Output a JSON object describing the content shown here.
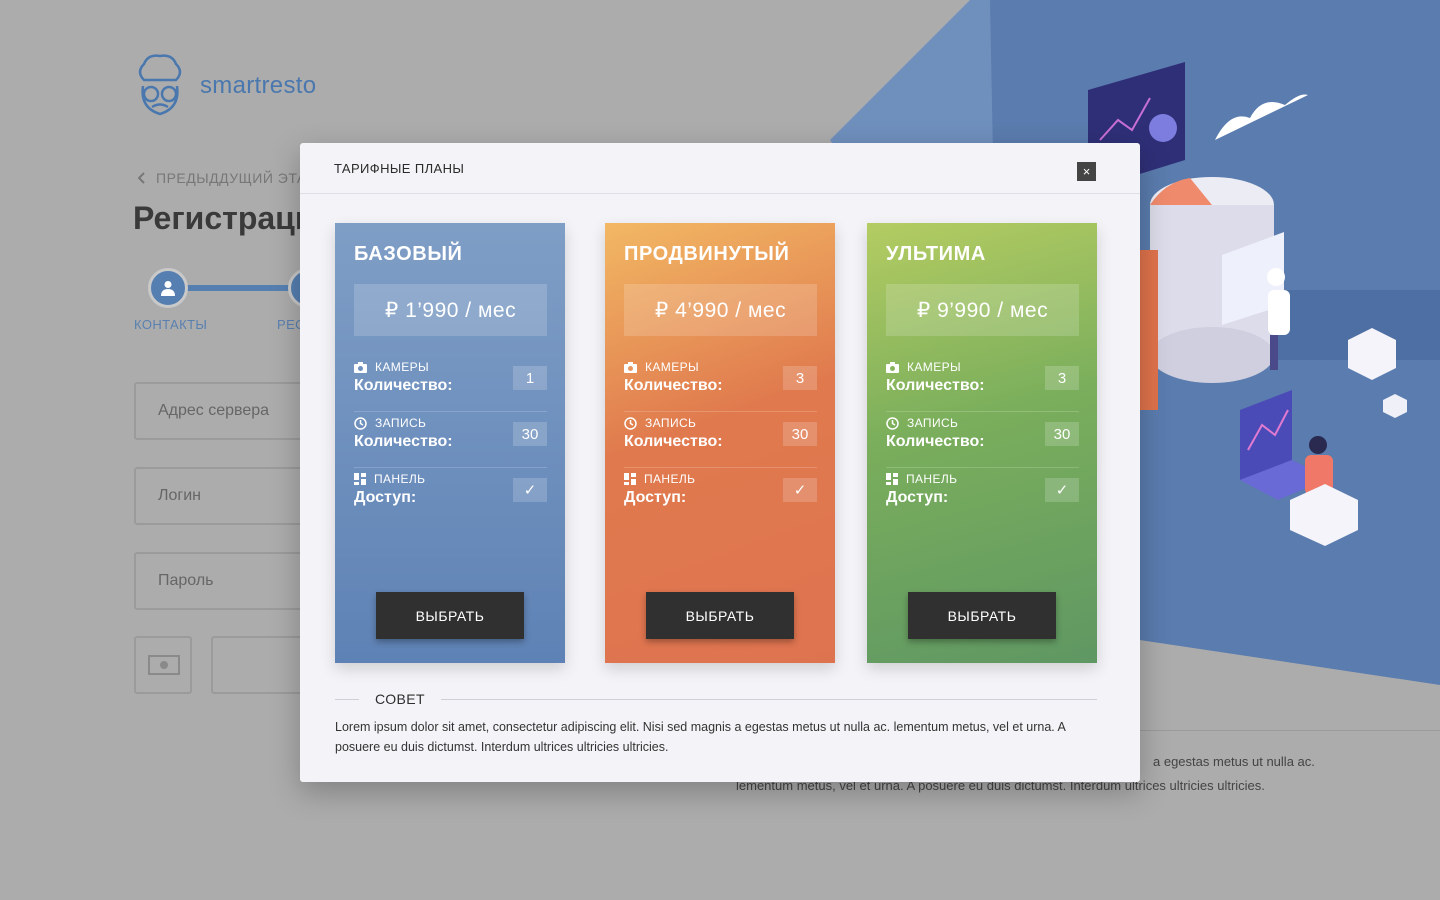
{
  "background": {
    "logo_text": "smartresto",
    "back_link": "ПРЕДЫДДУЩИЙ ЭТАП",
    "title": "Регистрация",
    "steps": [
      {
        "label": "КОНТАКТЫ"
      },
      {
        "label": "РЕС"
      }
    ],
    "inputs": [
      {
        "placeholder": "Адрес сервера"
      },
      {
        "placeholder": "Логин"
      },
      {
        "placeholder": "Пароль"
      }
    ],
    "footer_text_1": "a egestas metus ut nulla ac.",
    "footer_text_2": "lementum metus, vel et urna. A posuere eu duis dictumst. Interdum ultrices ultricies ultricies."
  },
  "modal": {
    "title": "ТАРИФНЫЕ ПЛАНЫ",
    "close_label": "×",
    "plans": [
      {
        "name": "БАЗОВЫЙ",
        "price": "₽ 1’990 / мес",
        "features": [
          {
            "caption": "КАМЕРЫ",
            "label": "Количество:",
            "value": "1",
            "icon": "camera-icon"
          },
          {
            "caption": "ЗАПИСЬ",
            "label": "Количество:",
            "value": "30",
            "icon": "clock-icon"
          },
          {
            "caption": "ПАНЕЛЬ",
            "label": "Доступ:",
            "value": "✓",
            "icon": "dashboard-icon"
          }
        ],
        "button": "ВЫБРАТЬ"
      },
      {
        "name": "ПРОДВИНУТЫЙ",
        "price": "₽ 4’990 / мес",
        "features": [
          {
            "caption": "КАМЕРЫ",
            "label": "Количество:",
            "value": "3",
            "icon": "camera-icon"
          },
          {
            "caption": "ЗАПИСЬ",
            "label": "Количество:",
            "value": "30",
            "icon": "clock-icon"
          },
          {
            "caption": "ПАНЕЛЬ",
            "label": "Доступ:",
            "value": "✓",
            "icon": "dashboard-icon"
          }
        ],
        "button": "ВЫБРАТЬ"
      },
      {
        "name": "УЛЬТИМА",
        "price": "₽ 9’990 / мес",
        "features": [
          {
            "caption": "КАМЕРЫ",
            "label": "Количество:",
            "value": "3",
            "icon": "camera-icon"
          },
          {
            "caption": "ЗАПИСЬ",
            "label": "Количество:",
            "value": "30",
            "icon": "clock-icon"
          },
          {
            "caption": "ПАНЕЛЬ",
            "label": "Доступ:",
            "value": "✓",
            "icon": "dashboard-icon"
          }
        ],
        "button": "ВЫБРАТЬ"
      }
    ],
    "tip": {
      "title": "СОВЕТ",
      "text": "Lorem ipsum dolor sit amet, consectetur adipiscing elit. Nisi sed magnis a egestas metus ut nulla ac. lementum metus, vel et urna. A posuere eu duis dictumst. Interdum ultrices ultricies ultricies."
    }
  },
  "colors": {
    "accent": "#567fb1",
    "plan_basic": "#6f91bf",
    "plan_advanced": "#e07a4e",
    "plan_ultima": "#7aae5c",
    "button_dark": "#303030"
  }
}
